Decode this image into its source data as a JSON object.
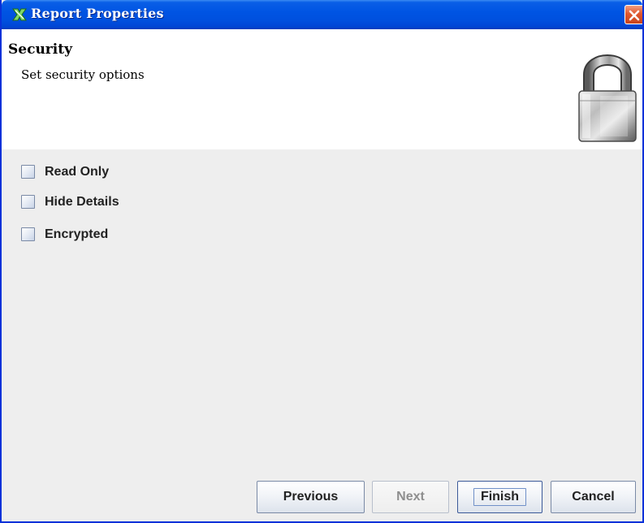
{
  "window": {
    "title": "Report Properties",
    "title_icon": "report-designer-icon",
    "close_icon": "close-icon"
  },
  "header": {
    "title": "Security",
    "subtitle": "Set security options",
    "icon": "padlock-icon"
  },
  "options": [
    {
      "label": "Read Only",
      "checked": false
    },
    {
      "label": "Hide Details",
      "checked": false
    },
    {
      "label": "Encrypted",
      "checked": false
    }
  ],
  "buttons": {
    "previous": "Previous",
    "next": "Next",
    "finish": "Finish",
    "cancel": "Cancel"
  },
  "colors": {
    "titlebar": "#0054e3",
    "close_button": "#e0582f",
    "panel_background": "#eeeeee",
    "header_background": "#ffffff"
  }
}
